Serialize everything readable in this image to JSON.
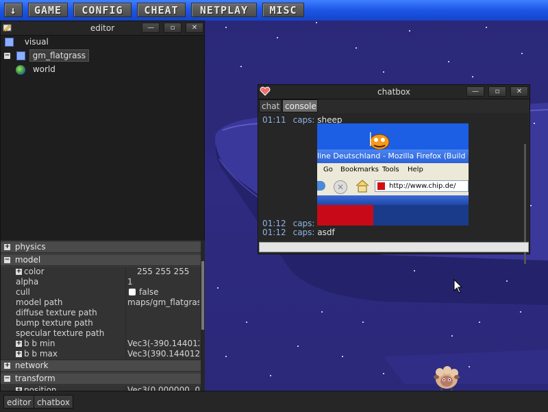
{
  "menu": {
    "items": [
      {
        "label": "↓"
      },
      {
        "label": "GAME"
      },
      {
        "label": "CONFIG"
      },
      {
        "label": "CHEAT"
      },
      {
        "label": "NETPLAY"
      },
      {
        "label": "MISC"
      }
    ]
  },
  "editor": {
    "title": "editor",
    "tree": [
      {
        "label": "visual"
      },
      {
        "label": "gm_flatgrass"
      },
      {
        "label": "world"
      }
    ],
    "properties": {
      "physics": "physics",
      "model": "model",
      "rows": [
        {
          "key": "color",
          "value": "255 255 255"
        },
        {
          "key": "alpha",
          "value": "1"
        },
        {
          "key": "cull",
          "value": "false"
        },
        {
          "key": "model path",
          "value": "maps/gm_flatgrass"
        },
        {
          "key": "diffuse texture path",
          "value": ""
        },
        {
          "key": "bump texture path",
          "value": ""
        },
        {
          "key": "specular texture path",
          "value": ""
        },
        {
          "key": "b b min",
          "value": "Vec3(-390.144012"
        },
        {
          "key": "b b max",
          "value": "Vec3(390.144012,"
        }
      ],
      "network": "network",
      "transform": "transform",
      "position": {
        "key": "position",
        "value": "Vec3(0.000000, 0"
      }
    }
  },
  "chatbox": {
    "title": "chatbox",
    "tabs": [
      {
        "label": "chat"
      },
      {
        "label": "console"
      }
    ],
    "messages": [
      {
        "time": "01:11",
        "name": "caps:",
        "text": "sheep"
      },
      {
        "time": "01:12",
        "name": "caps:",
        "text": ""
      },
      {
        "time": "01:12",
        "name": "caps:",
        "text": "asdf"
      }
    ],
    "input_value": "",
    "embedded_screenshot": {
      "title_text": "line Deutschland - Mozilla Firefox (Build",
      "menu": [
        "Go",
        "Bookmarks",
        "Tools",
        "Help"
      ],
      "url": "http://www.chip.de/"
    }
  },
  "taskbar": {
    "items": [
      {
        "label": "editor"
      },
      {
        "label": "chatbox"
      }
    ]
  },
  "colors": {
    "menu_blue": "#1c56e6",
    "sky": "#2a2775",
    "chat_name": "#8fb4e6"
  }
}
